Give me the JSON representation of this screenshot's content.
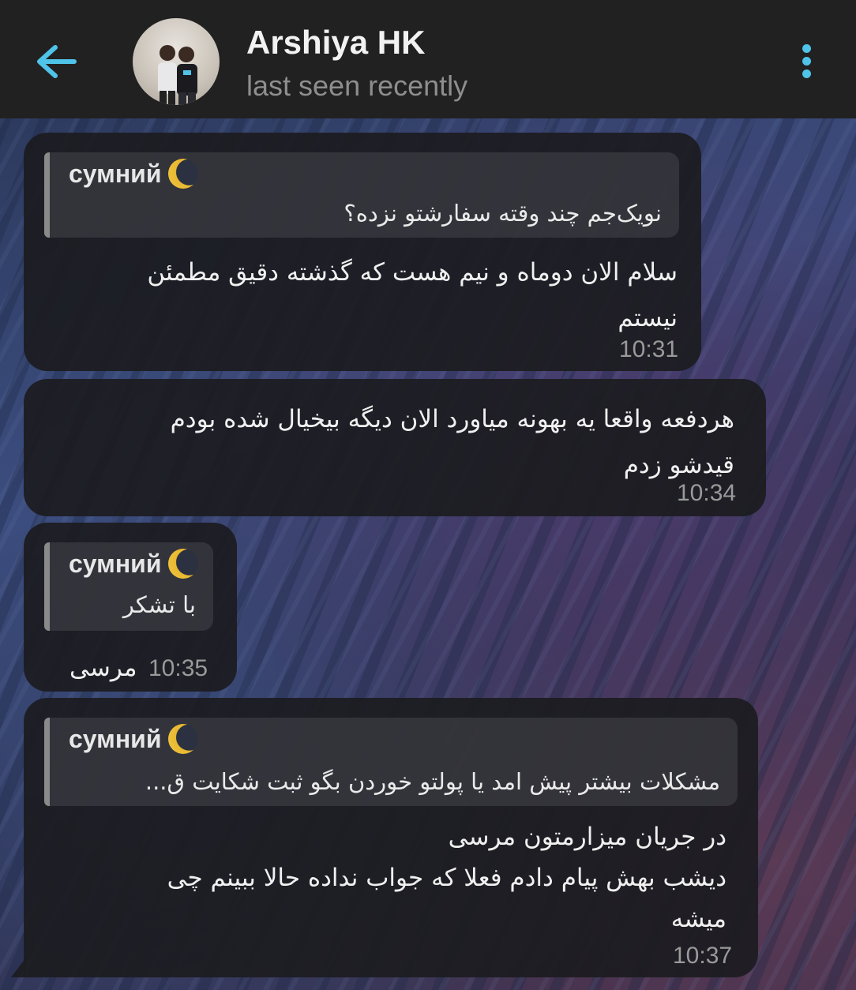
{
  "header": {
    "title": "Arshiya HK",
    "subtitle": "last seen recently"
  },
  "colors": {
    "accent": "#4fc3e8",
    "bubble": "#1c1c20",
    "header": "#212121"
  },
  "messages": [
    {
      "reply_name": "сумний",
      "reply_text": "نویک‌جم چند وقته سفارشتو نزده؟",
      "text_line1": "سلام الان دوماه و نیم هست که گذشته دقیق مطمئن",
      "text_line2": "نیستم",
      "time": "10:31"
    },
    {
      "text_line1": "هردفعه واقعا یه بهونه میاورد الان دیگه بیخیال شده بودم",
      "text_line2": "قیدشو زدم",
      "time": "10:34"
    },
    {
      "reply_name": "сумний",
      "reply_text": "با تشکر",
      "text": "مرسی",
      "time": "10:35"
    },
    {
      "reply_name": "сумний",
      "reply_text": "مشکلات بیشتر پیش امد یا پولتو خوردن بگو ثبت شکایت ق...",
      "text_line1": "در جریان میزارمتون مرسی",
      "text_line2": "دیشب بهش پیام دادم فعلا که جواب نداده حالا ببینم چی",
      "text_line3": "میشه",
      "time": "10:37"
    }
  ]
}
